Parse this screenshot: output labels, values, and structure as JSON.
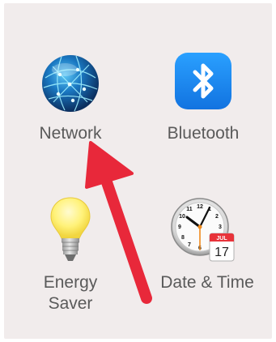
{
  "panes": {
    "network": {
      "label": "Network",
      "icon": "network-globe-icon"
    },
    "bluetooth": {
      "label": "Bluetooth",
      "icon": "bluetooth-icon"
    },
    "energy": {
      "label": "Energy\nSaver",
      "icon": "lightbulb-icon"
    },
    "datetime": {
      "label": "Date & Time",
      "icon": "clock-calendar-icon"
    }
  },
  "calendar_badge": {
    "month": "JUL",
    "day": "17"
  },
  "colors": {
    "panel_background": "#f1ecec",
    "label_text": "#5a5a5a",
    "bluetooth_blue": "#1e8cf5",
    "annotation_arrow": "#e8283a"
  }
}
